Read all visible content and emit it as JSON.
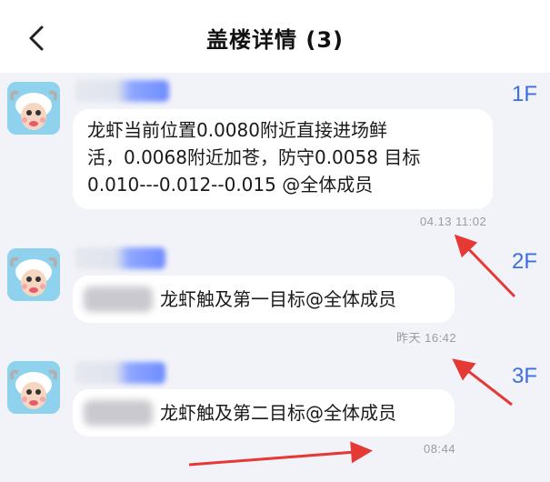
{
  "header": {
    "title": "盖楼详情 (3)"
  },
  "posts": [
    {
      "floor": "1F",
      "lines": [
        "龙虾当前位置0.0080附近直接进场鲜",
        "活，0.0068附近加苍，防守0.0058  目标",
        "0.010---0.012--0.015 @全体成员"
      ],
      "time": "04.13 11:02"
    },
    {
      "floor": "2F",
      "text": "龙虾触及第一目标@全体成员",
      "time": "昨天 16:42"
    },
    {
      "floor": "3F",
      "text": "龙虾触及第二目标@全体成员",
      "time": "08:44"
    }
  ],
  "colors": {
    "accent": "#3d6fe0",
    "annotation": "#e53935",
    "background": "#f2f3f8"
  }
}
